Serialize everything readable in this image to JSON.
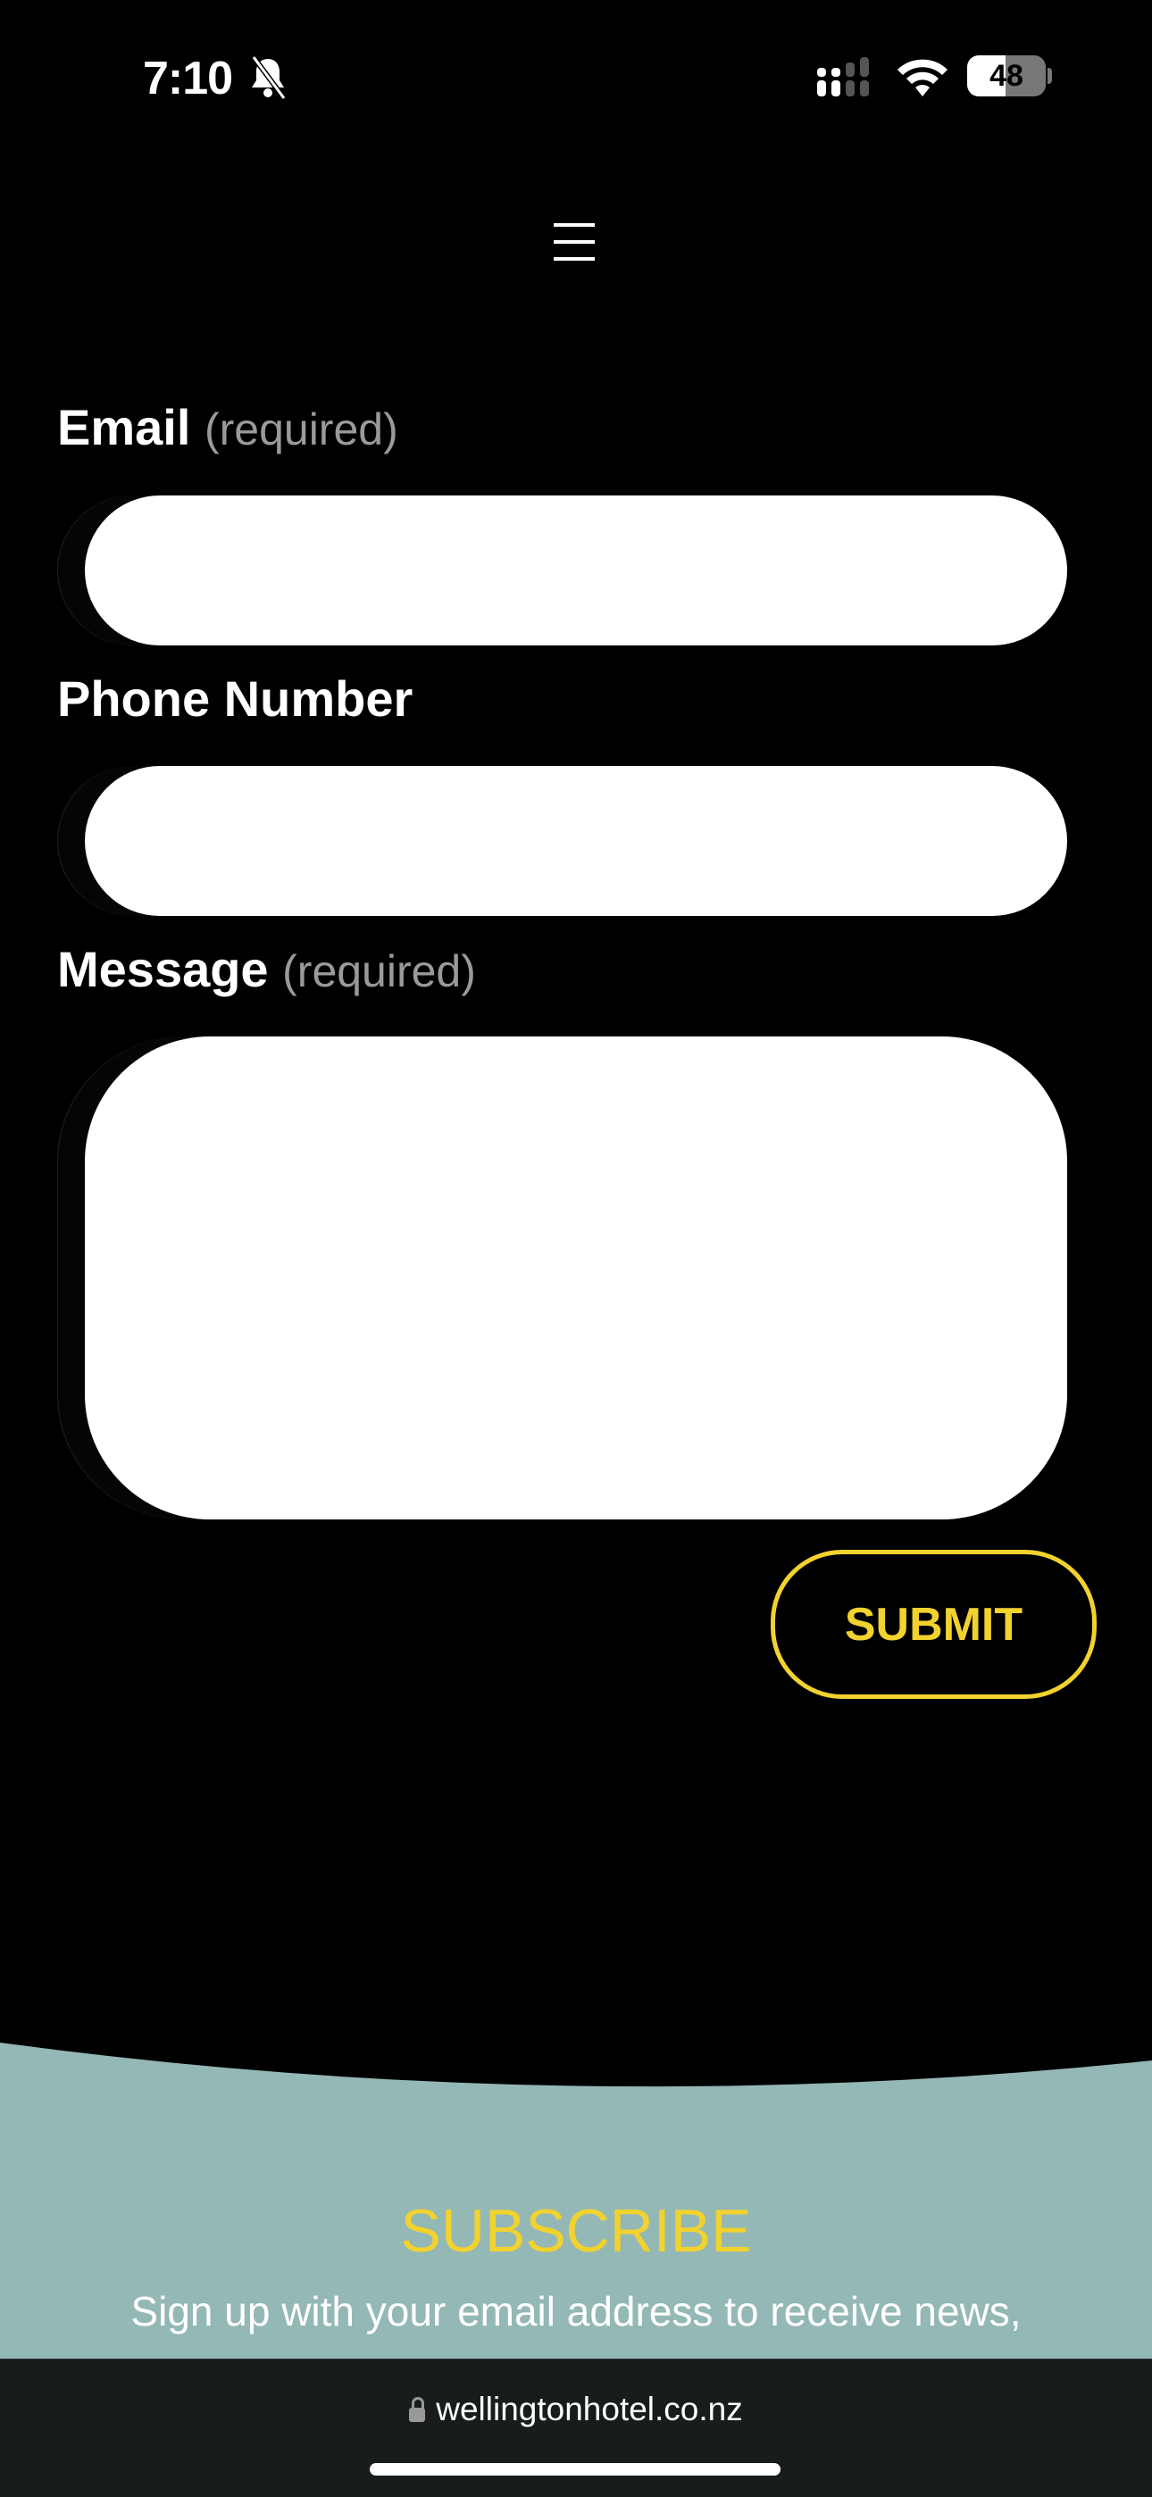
{
  "status_bar": {
    "time": "7:10",
    "battery": "48",
    "icons": [
      "bell-slash-icon",
      "signal-icon",
      "wifi-icon",
      "battery-icon"
    ]
  },
  "nav": {
    "menu_icon": "hamburger-icon"
  },
  "form": {
    "email": {
      "label": "Email",
      "required": "(required)",
      "value": ""
    },
    "phone": {
      "label": "Phone Number",
      "value": ""
    },
    "message": {
      "label": "Message",
      "required": "(required)",
      "value": ""
    },
    "submit_label": "SUBMIT"
  },
  "subscribe": {
    "title": "SUBSCRIBE",
    "text": "Sign up with your email address to receive news,"
  },
  "browser": {
    "url": "wellingtonhotel.co.nz"
  },
  "colors": {
    "accent": "#f2d22e",
    "teal": "#94b8b5",
    "background": "#000000",
    "browser_bar": "#181c1d"
  }
}
